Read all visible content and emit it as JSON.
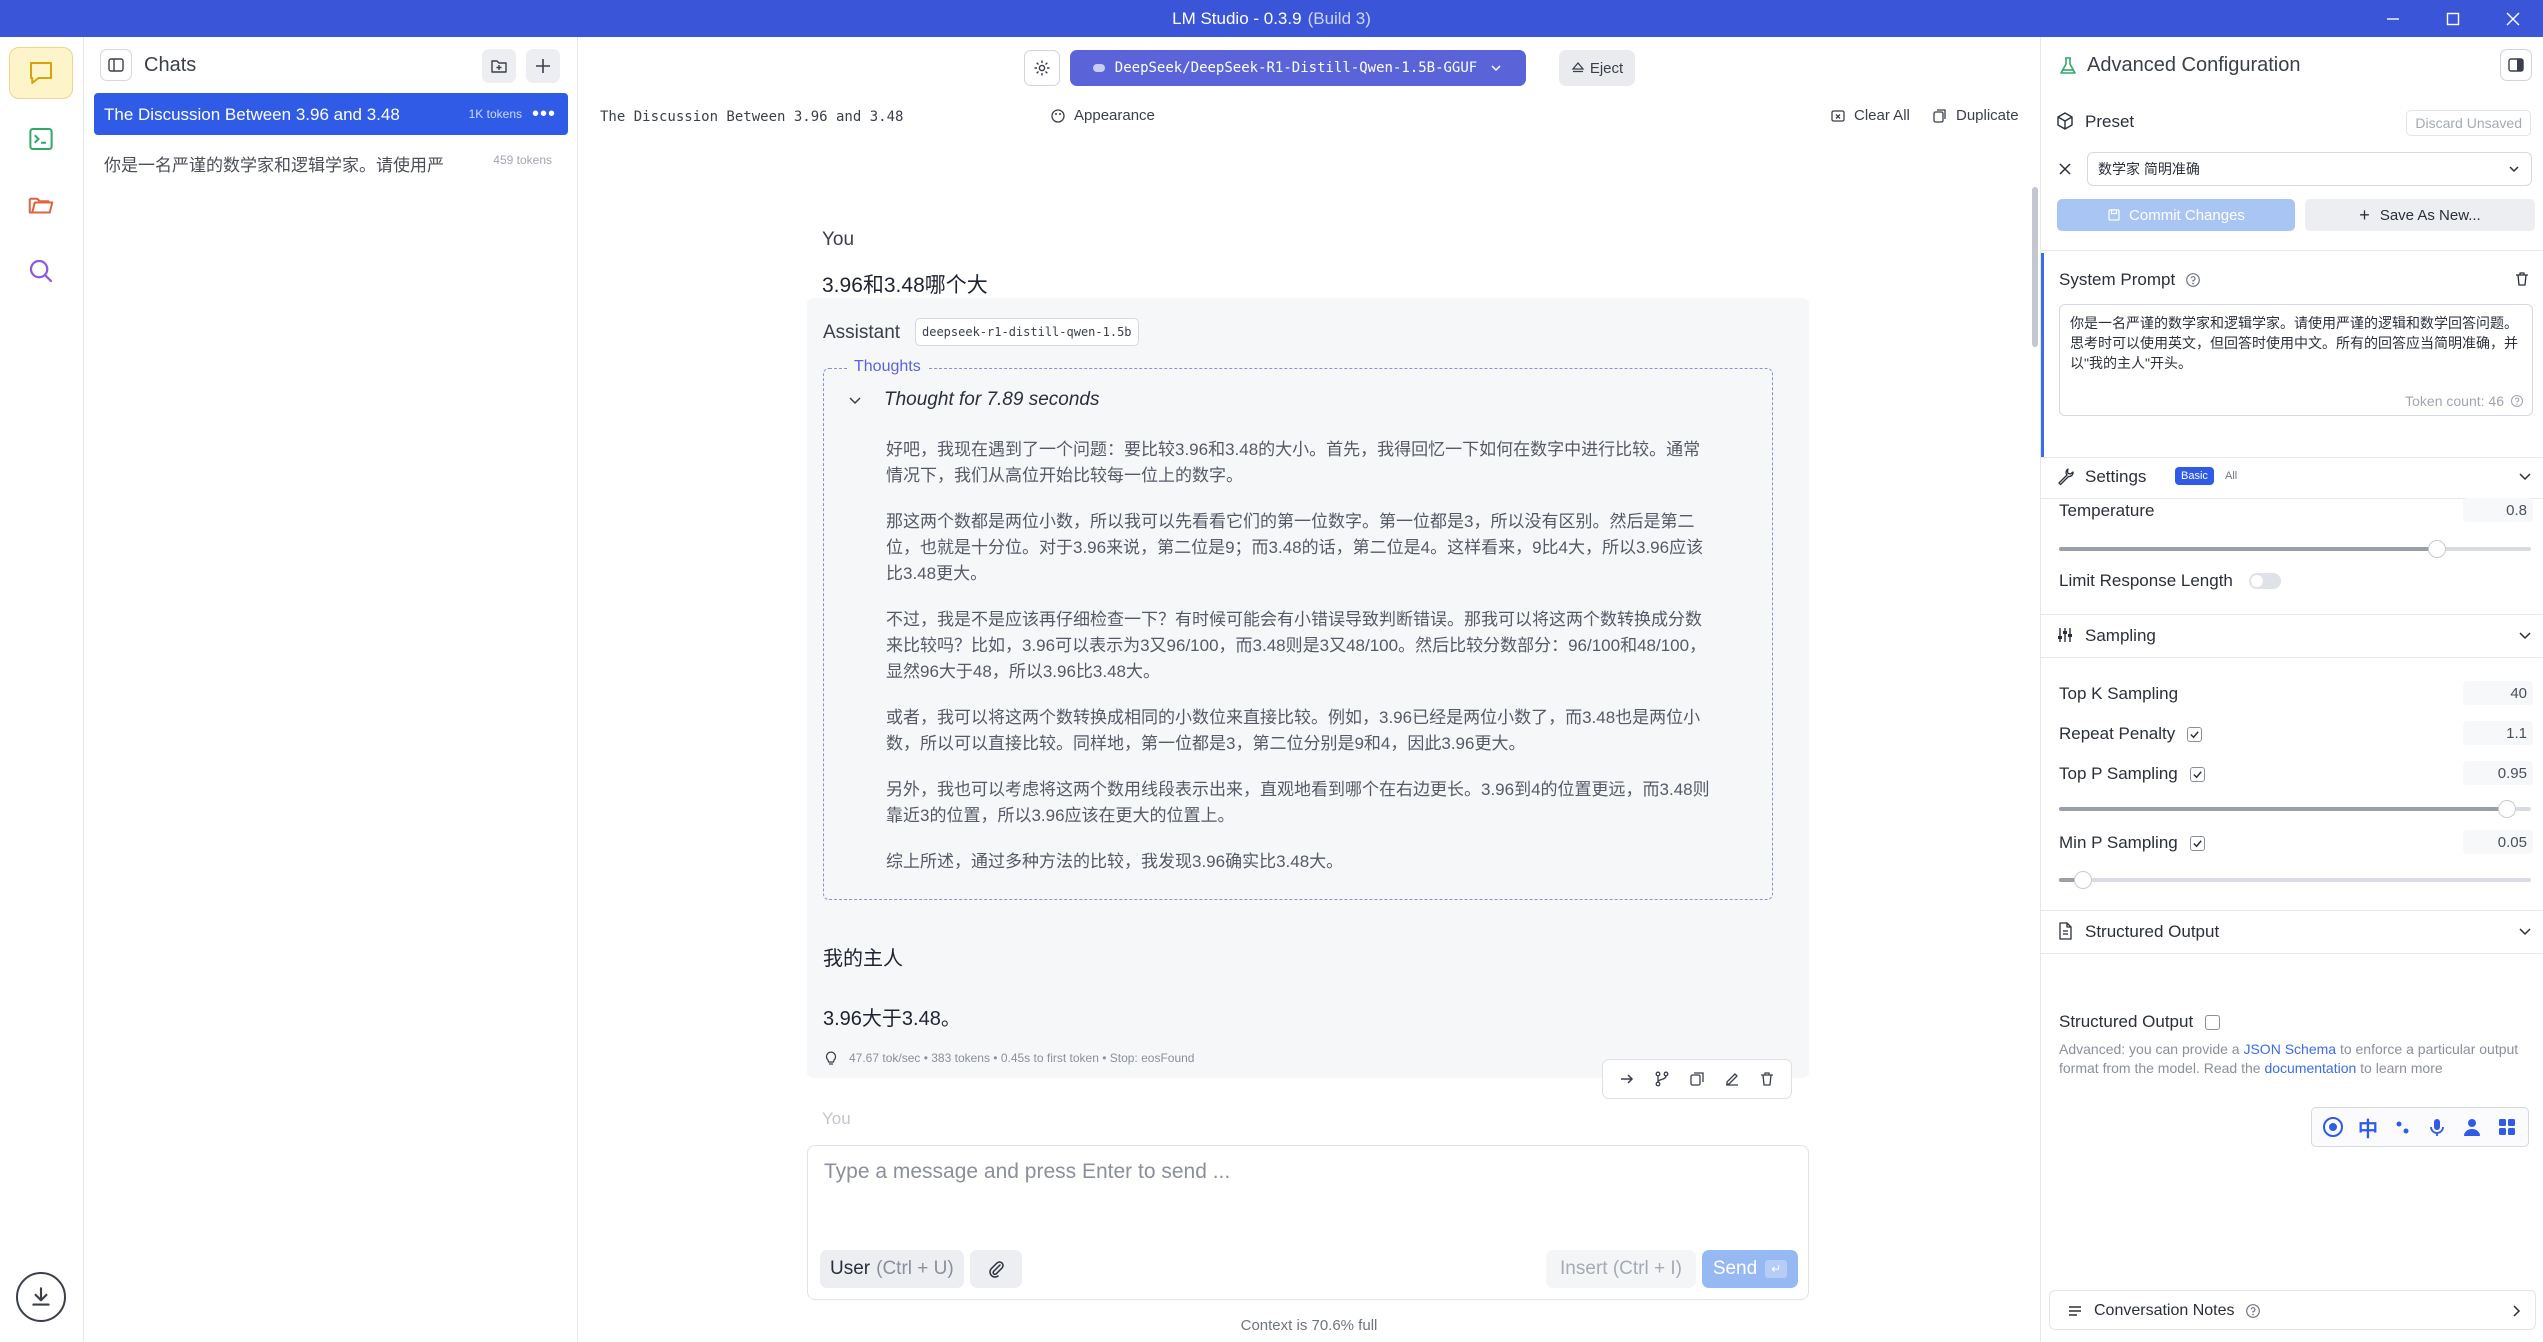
{
  "window": {
    "title": "LM Studio - 0.3.9",
    "build": "(Build 3)",
    "accent": "#3b55d9"
  },
  "rail": {
    "items": [
      {
        "name": "chat-icon",
        "active": true
      },
      {
        "name": "developer-icon",
        "active": false
      },
      {
        "name": "folder-icon",
        "active": false
      },
      {
        "name": "search-icon",
        "active": false
      }
    ]
  },
  "chats": {
    "title": "Chats",
    "items": [
      {
        "title": "The Discussion Between 3.96 and 3.48",
        "tokens": "1K tokens",
        "more": "•••",
        "selected": true
      },
      {
        "title": "你是一名严谨的数学家和逻辑学家。请使用严",
        "tokens": "459 tokens",
        "selected": false
      }
    ]
  },
  "topbar": {
    "model": "DeepSeek/DeepSeek-R1-Distill-Qwen-1.5B-GGUF",
    "eject": "Eject"
  },
  "conversation": {
    "title": "The Discussion Between 3.96 and 3.48",
    "actions": {
      "appearance": "Appearance",
      "clear_all": "Clear All",
      "duplicate": "Duplicate"
    }
  },
  "messages": {
    "user": {
      "role": "You",
      "text": "3.96和3.48哪个大"
    },
    "assistant": {
      "role": "Assistant",
      "model_tag": "deepseek-r1-distill-qwen-1.5b",
      "thoughts_label": "Thoughts",
      "thought_duration": "Thought for 7.89 seconds",
      "thoughts": [
        "好吧，我现在遇到了一个问题：要比较3.96和3.48的大小。首先，我得回忆一下如何在数字中进行比较。通常情况下，我们从高位开始比较每一位上的数字。",
        "那这两个数都是两位小数，所以我可以先看看它们的第一位数字。第一位都是3，所以没有区别。然后是第二位，也就是十分位。对于3.96来说，第二位是9；而3.48的话，第二位是4。这样看来，9比4大，所以3.96应该比3.48更大。",
        "不过，我是不是应该再仔细检查一下？有时候可能会有小错误导致判断错误。那我可以将这两个数转换成分数来比较吗？比如，3.96可以表示为3又96/100，而3.48则是3又48/100。然后比较分数部分：96/100和48/100，显然96大于48，所以3.96比3.48大。",
        "或者，我可以将这两个数转换成相同的小数位来直接比较。例如，3.96已经是两位小数了，而3.48也是两位小数，所以可以直接比较。同样地，第一位都是3，第二位分别是9和4，因此3.96更大。",
        "另外，我也可以考虑将这两个数用线段表示出来，直观地看到哪个在右边更长。3.96到4的位置更远，而3.48则靠近3的位置，所以3.96应该在更大的位置上。",
        "综上所述，通过多种方法的比较，我发现3.96确实比3.48大。"
      ],
      "answer_greeting": "我的主人",
      "answer": "3.96大于3.48。",
      "stats": "47.67 tok/sec • 383 tokens • 0.45s to first token • Stop: eosFound"
    },
    "next_peek": "You"
  },
  "composer": {
    "placeholder": "Type a message and press Enter to send ...",
    "role_label": "User",
    "role_shortcut": "(Ctrl + U)",
    "insert": "Insert (Ctrl + I)",
    "send": "Send",
    "send_hint": "↵"
  },
  "status": {
    "context": "Context is 70.6% full"
  },
  "config": {
    "title": "Advanced Configuration",
    "preset": {
      "label": "Preset",
      "discard": "Discard Unsaved",
      "value": "数学家 简明准确",
      "commit": "Commit Changes",
      "save_as": "Save As New..."
    },
    "system_prompt": {
      "label": "System Prompt",
      "text": "你是一名严谨的数学家和逻辑学家。请使用严谨的逻辑和数学回答问题。思考时可以使用英文，但回答时使用中文。所有的回答应当简明准确，并以\"我的主人\"开头。",
      "token_count": "Token count: 46"
    },
    "settings": {
      "label": "Settings",
      "basic": "Basic",
      "all": "All",
      "temperature": {
        "label": "Temperature",
        "value": "0.8",
        "fraction": 0.8
      },
      "limit_length": {
        "label": "Limit Response Length",
        "on": false
      }
    },
    "sampling": {
      "label": "Sampling",
      "top_k": {
        "label": "Top K Sampling",
        "value": "40"
      },
      "repeat_penalty": {
        "label": "Repeat Penalty",
        "value": "1.1",
        "checked": true
      },
      "top_p": {
        "label": "Top P Sampling",
        "value": "0.95",
        "checked": true,
        "fraction": 0.95
      },
      "min_p": {
        "label": "Min P Sampling",
        "value": "0.05",
        "checked": true,
        "fraction": 0.05
      }
    },
    "structured": {
      "label": "Structured Output",
      "checkbox_label": "Structured Output",
      "help_before": "Advanced: you can provide a ",
      "help_link1": "JSON Schema",
      "help_middle": " to enforce a particular output format from the model. Read the ",
      "help_link2": "documentation",
      "help_after": " to learn more"
    },
    "ime": {
      "lang": "中"
    },
    "notes": {
      "label": "Conversation Notes"
    }
  }
}
